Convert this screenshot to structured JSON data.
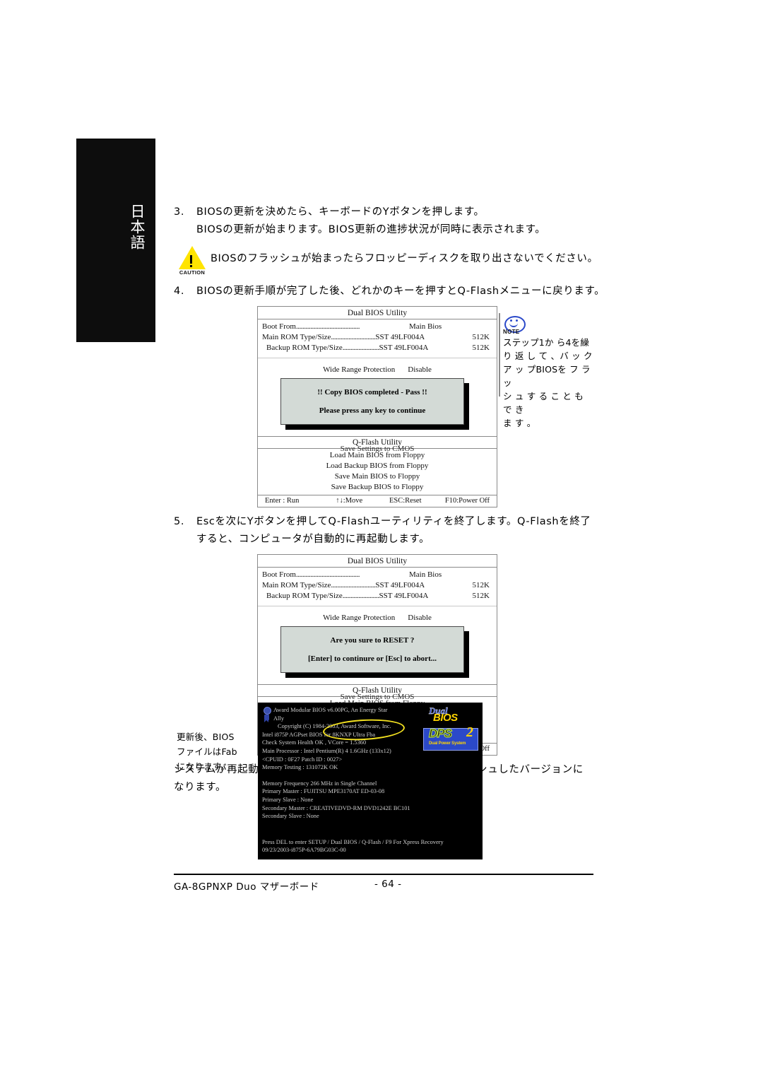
{
  "sidebar": {
    "language_tab": "日本語"
  },
  "steps": {
    "step3": {
      "num": "3.",
      "line1": "BIOSの更新を決めたら、キーボードのYボタンを押します。",
      "line2": "BIOSの更新が始まります。BIOS更新の進捗状況が同時に表示されます。"
    },
    "caution": {
      "icon_label": "CAUTION",
      "text": "BIOSのフラッシュが始まったらフロッピーディスクを取り出さないでください。"
    },
    "step4": {
      "num": "4.",
      "line1": "BIOSの更新手順が完了した後、どれかのキーを押すとQ-Flashメニューに戻ります。"
    },
    "step5": {
      "num": "5.",
      "line1": "Escを次にYボタンを押してQ-Flashユーティリティを終了します。Q-Flashを終了",
      "line2": "すると、コンピュータが自動的に再起動します。"
    },
    "after_reboot": {
      "line1": "システムが再起動した後、起動画面のBIOSバージョンはフラッシュしたバージョンに",
      "line2": "なります。"
    }
  },
  "note": {
    "icon_label": "NOTE",
    "lines": [
      "ステップ1か ら4を繰",
      "り 返 し て 、バ ッ ク",
      "ア ッ プBIOSを フ ラッ",
      "シ ュ す る こ と も で き",
      "ま す 。"
    ]
  },
  "post_note": {
    "lines": [
      "更新後、BIOS",
      "ファイルはFab",
      "になります。"
    ]
  },
  "bios_utility": {
    "title": "Dual BIOS Utility",
    "boot_from_label": "Boot From",
    "boot_from_dots": "........................................",
    "boot_from_value": "Main Bios",
    "main_rom_label": "Main ROM Type/Size",
    "main_rom_dots": "............................",
    "main_rom_value": "SST 49LF004A",
    "main_rom_size": "512K",
    "backup_rom_label": "Backup ROM Type/Size",
    "backup_rom_dots": ".......................",
    "backup_rom_value": "SST 49LF004A",
    "backup_rom_size": "512K",
    "wide_range_label": "Wide Range Protection",
    "wide_range_value": "Disable",
    "occluded_row": "Save Settings to CMOS",
    "qflash_title": "Q-Flash Utility",
    "qflash_items": [
      "Load Main BIOS from Floppy",
      "Load Backup BIOS from Floppy",
      "Save Main BIOS to Floppy",
      "Save Backup BIOS to Floppy"
    ],
    "footer": [
      "Enter : Run",
      "↑↓:Move",
      "ESC:Reset",
      "F10:Power Off"
    ]
  },
  "dialog1": {
    "line1": "!! Copy BIOS completed - Pass !!",
    "line2": "Please press any key to continue"
  },
  "dialog2": {
    "line1": "Are you sure to RESET ?",
    "line2": "[Enter] to continure or [Esc] to abort..."
  },
  "post_screen": {
    "line_award": "Award Modular BIOS v6.00PG, An Energy Star",
    "line_ally": "Ally",
    "line_copyright": "Copyright  (C) 1984-2003, Award Software,  Inc.",
    "line_agpset": "Intel i875P AGPset BIOS  for 8KNXP Ultra Fba",
    "line_health": "Check System Health OK , VCore = 1.5360",
    "line_cpu": "Main Processor : Intel Pentium(R) 4  1.6GHz (133x12)",
    "line_cpuid": "<CPUID : 0F27 Patch ID  : 0027>",
    "line_mem": "Memory Testing  : 131072K OK",
    "line_memfreq": "Memory Frequency 266 MHz in Single Channel",
    "line_pri_master": "Primary Master : FUJITSU MPE3170AT ED-03-08",
    "line_pri_slave": "Primary Slave : None",
    "line_sec_master": "Secondary Master : CREATIVEDVD-RM DVD1242E BC101",
    "line_sec_slave": "Secondary Slave : None",
    "line_press": "Press DEL to enter SETUP / Dual BIOS / Q-Flash / F9 For Xpress Recovery",
    "line_build": "09/23/2003-i875P-6A79BG03C-00",
    "logo_dual_top": "Dual",
    "logo_dual_bottom": "BIOS",
    "logo_dps_text": "DPS",
    "logo_dps_num": "2",
    "logo_dps_sub": "Dual Power System",
    "highlight_color": "#f2e020"
  },
  "footer": {
    "model": "GA-8GPNXP Duo マザーボード",
    "page": "- 64 -"
  }
}
